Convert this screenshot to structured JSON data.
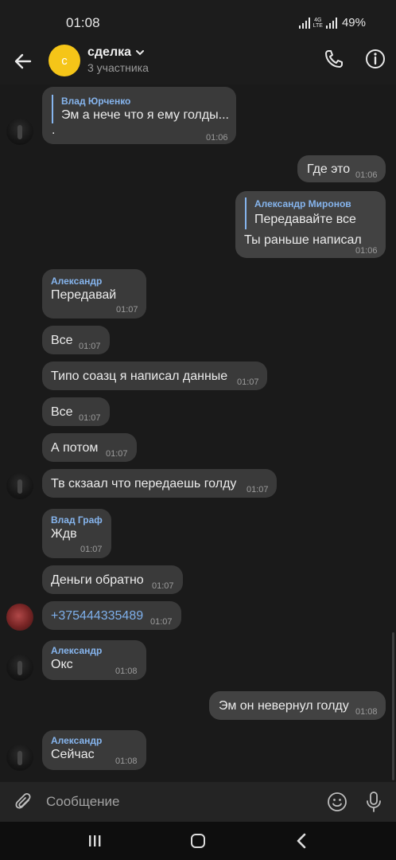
{
  "status_bar": {
    "time": "01:08",
    "network_top": "4G",
    "network_bottom": "LTE",
    "battery": "49%"
  },
  "header": {
    "avatar_letter": "с",
    "title": "сделка",
    "subtitle": "3 участника"
  },
  "messages": [
    {
      "sender": "Влад Юрченко",
      "text": "Эм а нече что я ему голды...",
      "text2": ".",
      "time": "01:06"
    },
    {
      "text": "Где это",
      "time": "01:06"
    },
    {
      "reply_sender": "Александр Миронов",
      "reply_text": "Передавайте все",
      "text": "Ты раньше написал",
      "time": "01:06"
    },
    {
      "sender": "Александр",
      "text": "Передавай",
      "time": "01:07"
    },
    {
      "text": "Все",
      "time": "01:07"
    },
    {
      "text": "Типо соазц я написал данные",
      "time": "01:07"
    },
    {
      "text": "Все",
      "time": "01:07"
    },
    {
      "text": "А потом",
      "time": "01:07"
    },
    {
      "text": "Тв скзаал что передаешь голду",
      "time": "01:07"
    },
    {
      "sender": "Влад Граф",
      "text": "Ждв",
      "time": "01:07"
    },
    {
      "text": "Деньги обратно",
      "time": "01:07"
    },
    {
      "text": "+375444335489",
      "time": "01:07"
    },
    {
      "sender": "Александр",
      "text": "Окс",
      "time": "01:08"
    },
    {
      "text": "Эм он невернул голду",
      "time": "01:08"
    },
    {
      "sender": "Александр",
      "text": "Сейчас",
      "time": "01:08"
    }
  ],
  "composer": {
    "placeholder": "Сообщение"
  },
  "colors": {
    "accent": "#86b5ee",
    "avatar_bg": "#f5c518",
    "incoming_bubble": "#3a3a3a",
    "outgoing_bubble": "#424242",
    "background": "#1a1a1a"
  },
  "icons": [
    "back-arrow-icon",
    "chevron-down-icon",
    "phone-icon",
    "info-icon",
    "paperclip-icon",
    "emoji-icon",
    "microphone-icon",
    "recent-apps-icon",
    "home-icon",
    "nav-back-icon"
  ]
}
